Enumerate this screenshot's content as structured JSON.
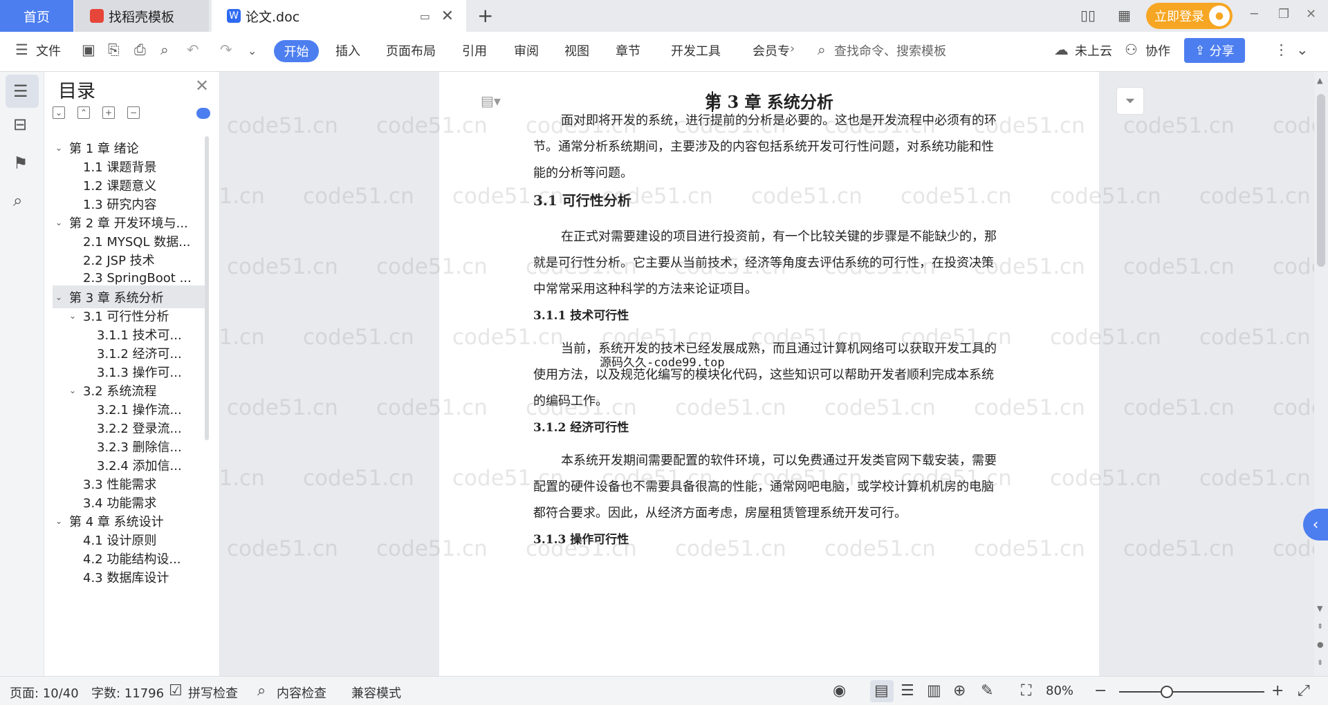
{
  "tabs": {
    "home": "首页",
    "daoke": "找稻壳模板",
    "doc": "论文.doc",
    "new_tab": "+"
  },
  "topbar": {
    "login": "立即登录",
    "avatar_icon": "user-avatar"
  },
  "toolbar": {
    "menu_file": "文件",
    "tabs": [
      "开始",
      "插入",
      "页面布局",
      "引用",
      "审阅",
      "视图",
      "章节",
      "开发工具",
      "会员专"
    ],
    "search_placeholder": "查找命令、搜索模板",
    "cloud": "未上云",
    "collab": "协作",
    "share": "分享"
  },
  "toc": {
    "title": "目录",
    "items": [
      {
        "label": "第 1 章  绪论",
        "level": 1,
        "expandable": true
      },
      {
        "label": "1.1  课题背景",
        "level": 2,
        "expandable": false
      },
      {
        "label": "1.2  课题意义",
        "level": 2,
        "expandable": false
      },
      {
        "label": "1.3  研究内容",
        "level": 2,
        "expandable": false
      },
      {
        "label": "第 2 章  开发环境与...",
        "level": 1,
        "expandable": true
      },
      {
        "label": "2.1 MYSQL 数据...",
        "level": 2,
        "expandable": false
      },
      {
        "label": "2.2 JSP 技术",
        "level": 2,
        "expandable": false
      },
      {
        "label": "2.3 SpringBoot ...",
        "level": 2,
        "expandable": false
      },
      {
        "label": "第 3 章  系统分析",
        "level": 1,
        "expandable": true,
        "selected": true
      },
      {
        "label": "3.1  可行性分析",
        "level": 2,
        "expandable": true
      },
      {
        "label": "3.1.1  技术可...",
        "level": 3,
        "expandable": false
      },
      {
        "label": "3.1.2  经济可...",
        "level": 3,
        "expandable": false
      },
      {
        "label": "3.1.3  操作可...",
        "level": 3,
        "expandable": false
      },
      {
        "label": "3.2  系统流程",
        "level": 2,
        "expandable": true
      },
      {
        "label": "3.2.1  操作流...",
        "level": 3,
        "expandable": false
      },
      {
        "label": "3.2.2  登录流...",
        "level": 3,
        "expandable": false
      },
      {
        "label": "3.2.3  删除信...",
        "level": 3,
        "expandable": false
      },
      {
        "label": "3.2.4  添加信...",
        "level": 3,
        "expandable": false
      },
      {
        "label": "3.3  性能需求",
        "level": 2,
        "expandable": false
      },
      {
        "label": "3.4  功能需求",
        "level": 2,
        "expandable": false
      },
      {
        "label": "第 4 章  系统设计",
        "level": 1,
        "expandable": true
      },
      {
        "label": "4.1  设计原则",
        "level": 2,
        "expandable": false
      },
      {
        "label": "4.2  功能结构设...",
        "level": 2,
        "expandable": false
      },
      {
        "label": "4.3  数据库设计",
        "level": 2,
        "expandable": false
      }
    ]
  },
  "document": {
    "chapter_title": "第 3 章  系统分析",
    "intro": "面对即将开发的系统，进行提前的分析是必要的。这也是开发流程中必须有的环节。通常分析系统期间，主要涉及的内容包括系统开发可行性问题，对系统功能和性能的分析等问题。",
    "h31": "3.1  可行性分析",
    "p31": "在正式对需要建设的项目进行投资前，有一个比较关键的步骤是不能缺少的，那就是可行性分析。它主要从当前技术，经济等角度去评估系统的可行性，在投资决策中常常采用这种科学的方法来论证项目。",
    "source_note": "源码久久-code99.top",
    "h311": "3.1.1  技术可行性",
    "p311": "当前，系统开发的技术已经发展成熟，而且通过计算机网络可以获取开发工具的使用方法，以及规范化编写的模块化代码，这些知识可以帮助开发者顺利完成本系统的编码工作。",
    "h312": "3.1.2  经济可行性",
    "p312": "本系统开发期间需要配置的软件环境，可以免费通过开发类官网下载安装，需要配置的硬件设备也不需要具备很高的性能，通常网吧电脑，或学校计算机机房的电脑都符合要求。因此，从经济方面考虑，房屋租赁管理系统开发可行。",
    "h313": "3.1.3  操作可行性"
  },
  "watermark": "code51.cn",
  "status": {
    "page": "页面: 10/40",
    "words": "字数: 11796",
    "spell": "拼写检查",
    "content_check": "内容检查",
    "compat": "兼容模式",
    "zoom": "80%",
    "zoom_level": 0.33
  },
  "colors": {
    "accent": "#4d7ef0",
    "login": "#f6a623"
  }
}
